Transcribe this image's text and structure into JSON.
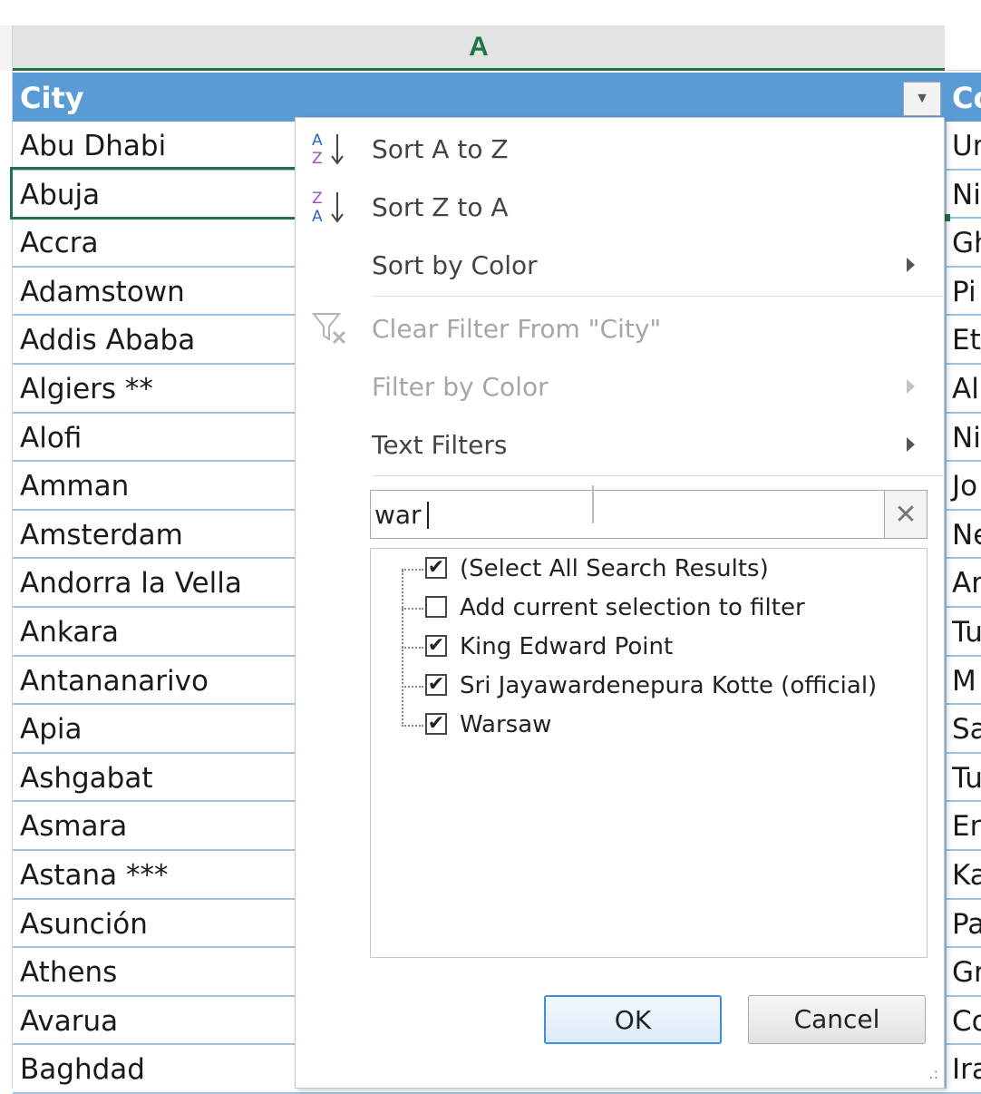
{
  "column_header": {
    "label": "A"
  },
  "table": {
    "header_city": "City",
    "header_country": "Co",
    "rows": [
      {
        "city": "Abu Dhabi",
        "country": "Ur"
      },
      {
        "city": "Abuja",
        "country": "Ni"
      },
      {
        "city": "Accra",
        "country": "Gh"
      },
      {
        "city": "Adamstown",
        "country": "Pi"
      },
      {
        "city": "Addis Ababa",
        "country": "Et"
      },
      {
        "city": "Algiers **",
        "country": "Al"
      },
      {
        "city": "Alofi",
        "country": "Ni"
      },
      {
        "city": "Amman",
        "country": "Jo"
      },
      {
        "city": "Amsterdam",
        "country": "Ne"
      },
      {
        "city": "Andorra la Vella",
        "country": "An"
      },
      {
        "city": "Ankara",
        "country": "Tu"
      },
      {
        "city": "Antananarivo",
        "country": "M"
      },
      {
        "city": "Apia",
        "country": "Sa"
      },
      {
        "city": "Ashgabat",
        "country": "Tu"
      },
      {
        "city": "Asmara",
        "country": "Er"
      },
      {
        "city": "Astana ***",
        "country": "Ka"
      },
      {
        "city": "Asunción",
        "country": "Pa"
      },
      {
        "city": "Athens",
        "country": "Gr"
      },
      {
        "city": "Avarua",
        "country": "Co"
      },
      {
        "city": "Baghdad",
        "country": "Ira"
      }
    ]
  },
  "filter_menu": {
    "sort_az": "Sort A to Z",
    "sort_za": "Sort Z to A",
    "sort_by_color": "Sort by Color",
    "clear_filter": "Clear Filter From \"City\"",
    "filter_by_color": "Filter by Color",
    "text_filters": "Text Filters",
    "search_value": "war",
    "items": [
      {
        "label": "(Select All Search Results)",
        "checked": true
      },
      {
        "label": "Add current selection to filter",
        "checked": false
      },
      {
        "label": "King Edward Point",
        "checked": true
      },
      {
        "label": "Sri Jayawardenepura Kotte (official)",
        "checked": true
      },
      {
        "label": "Warsaw",
        "checked": true
      }
    ],
    "ok_label": "OK",
    "cancel_label": "Cancel"
  },
  "colors": {
    "table_header": "#5b9bd5",
    "row_border": "#9dc3e6",
    "active_green": "#217346"
  }
}
